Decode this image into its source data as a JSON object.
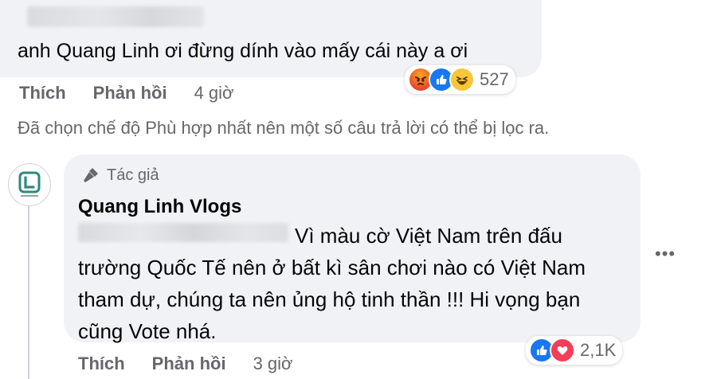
{
  "comment": {
    "text": "anh Quang Linh ơi đừng dính vào mấy cái này a ơi",
    "reactions": {
      "icons": [
        "angry-icon",
        "like-icon",
        "haha-icon"
      ],
      "count": "527"
    },
    "actions": {
      "like": "Thích",
      "reply": "Phản hồi",
      "time": "4 giờ"
    }
  },
  "filter_note": "Đã chọn chế độ Phù hợp nhất nên một số câu trả lời có thể bị lọc ra.",
  "reply": {
    "badge": "Tác giả",
    "author": "Quang Linh Vlogs",
    "text": "Vì màu cờ Việt Nam trên đấu trường Quốc Tế nên ở bất kì sân chơi nào có Việt Nam tham dự, chúng ta nên ủng hộ tinh thần !!! Hi vọng bạn cũng Vote nhá.",
    "reactions": {
      "icons": [
        "like-icon",
        "love-icon"
      ],
      "count": "2,1K"
    },
    "actions": {
      "like": "Thích",
      "reply": "Phản hồi",
      "time": "3 giờ"
    },
    "more": "•••"
  },
  "colors": {
    "bubble": "#f0f2f5",
    "secondary_text": "#65676b",
    "like_blue": "#1877f2",
    "love_red": "#f33e58"
  }
}
